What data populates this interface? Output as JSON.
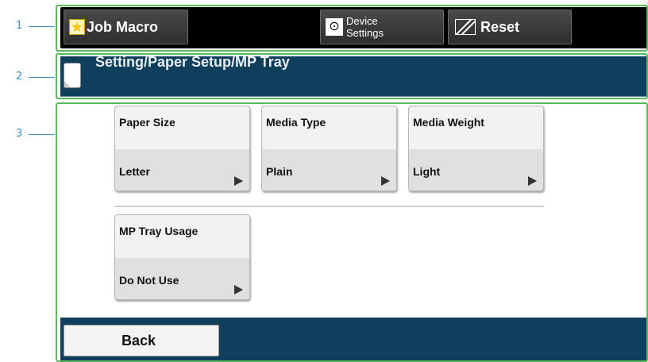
{
  "callouts": [
    "1",
    "2",
    "3"
  ],
  "topbar": {
    "job_macro": "Job Macro",
    "device_settings_line1": "Device",
    "device_settings_line2": "Settings",
    "reset": "Reset"
  },
  "title": "Setting/Paper Setup/MP Tray",
  "tiles": [
    {
      "name": "Paper Size",
      "value": "Letter"
    },
    {
      "name": "Media Type",
      "value": "Plain"
    },
    {
      "name": "Media Weight",
      "value": "Light"
    },
    {
      "name": "MP Tray Usage",
      "value": "Do Not Use"
    }
  ],
  "back_label": "Back",
  "colors": {
    "accent": "#0f3f5a",
    "callout": "#3a8fd0",
    "frame": "#5cb85c"
  }
}
